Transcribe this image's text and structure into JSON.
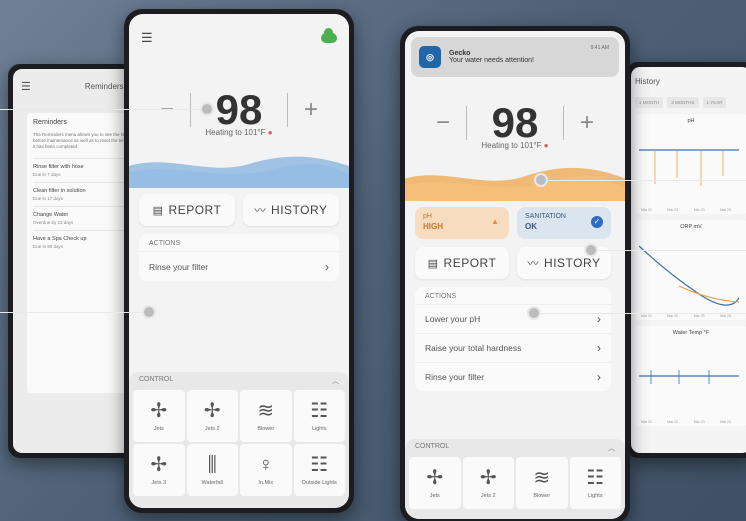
{
  "reminders_screen": {
    "title": "Reminders",
    "card_title": "Reminders",
    "description": "The Reminders menu allows you to see the time left before maintenance as well as to reset the time once it has been completed.",
    "items": [
      {
        "name": "Rinse filter with hose",
        "due": "Due in 7 days"
      },
      {
        "name": "Clean filter in solution",
        "due": "Due in 17 days"
      },
      {
        "name": "Change Water",
        "due": "Overdue by 23 days"
      },
      {
        "name": "Have a Spa Check up",
        "due": "Due in 90 days"
      }
    ]
  },
  "main_screen": {
    "temperature": "98",
    "minus": "−",
    "plus": "+",
    "heating_label": "Heating to 101°F",
    "report_label": "REPORT",
    "history_label": "HISTORY",
    "actions_header": "ACTIONS",
    "actions": [
      "Rinse your filter"
    ],
    "control_header": "CONTROL",
    "controls": [
      {
        "label": "Jets",
        "icon": "fan-icon"
      },
      {
        "label": "Jets 2",
        "icon": "fan-icon"
      },
      {
        "label": "Blower",
        "icon": "wind-icon"
      },
      {
        "label": "Lights",
        "icon": "light-icon"
      },
      {
        "label": "Jets 3",
        "icon": "fan-icon"
      },
      {
        "label": "Waterfall",
        "icon": "waterfall-icon"
      },
      {
        "label": "In.Mix",
        "icon": "bulb-icon"
      },
      {
        "label": "Outside Lights",
        "icon": "light-icon"
      }
    ],
    "colors": {
      "wave": "#5b9bd5",
      "accent": "#4caf50",
      "heating_dot": "#e05a4f"
    }
  },
  "alert_screen": {
    "notification": {
      "app": "Gecko",
      "message": "Your water needs attention!",
      "time": "9:41 AM"
    },
    "temperature": "98",
    "minus": "−",
    "plus": "+",
    "heating_label": "Heating to 101°F",
    "ph_label": "pH",
    "ph_value": "HIGH",
    "sanitation_label": "SANITATION",
    "sanitation_value": "OK",
    "report_label": "REPORT",
    "history_label": "HISTORY",
    "actions_header": "ACTIONS",
    "actions": [
      "Lower your pH",
      "Raise your total hardness",
      "Rinse your filter"
    ],
    "control_header": "CONTROL",
    "controls": [
      {
        "label": "Jets",
        "icon": "fan-icon"
      },
      {
        "label": "Jets 2",
        "icon": "fan-icon"
      },
      {
        "label": "Blower",
        "icon": "wind-icon"
      },
      {
        "label": "Lights",
        "icon": "light-icon"
      }
    ],
    "colors": {
      "wave": "#f0a040",
      "ph_bg": "#f8dcc0",
      "san_bg": "#dbe5ef"
    }
  },
  "history_screen": {
    "title": "History",
    "tabs": [
      "1 MONTH",
      "3 MONTHS",
      "1 YEAR"
    ],
    "charts": [
      {
        "title": "pH"
      },
      {
        "title": "ORP mV"
      },
      {
        "title": "Water Temp °F"
      }
    ],
    "x_ticks": [
      "Mar 21",
      "Mar 22",
      "Mar 23",
      "Mar 24"
    ]
  }
}
